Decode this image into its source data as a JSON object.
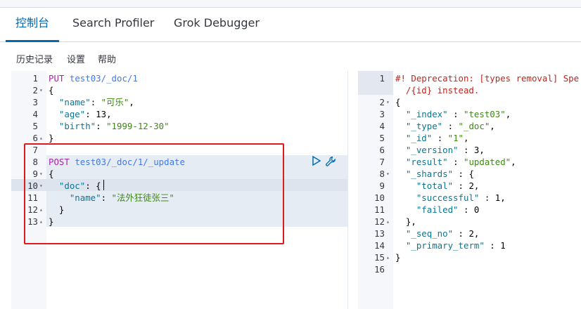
{
  "tabs": [
    {
      "label": "控制台",
      "active": true
    },
    {
      "label": "Search Profiler",
      "active": false
    },
    {
      "label": "Grok Debugger",
      "active": false
    }
  ],
  "menu": {
    "history": "历史记录",
    "settings": "设置",
    "help": "帮助"
  },
  "request_lines": [
    {
      "n": "1",
      "fold": "",
      "text": "PUT test03/_doc/1"
    },
    {
      "n": "2",
      "fold": "▾",
      "text": "{"
    },
    {
      "n": "3",
      "fold": "",
      "text": "  \"name\": \"可乐\","
    },
    {
      "n": "4",
      "fold": "",
      "text": "  \"age\": 13,"
    },
    {
      "n": "5",
      "fold": "",
      "text": "  \"birth\": \"1999-12-30\""
    },
    {
      "n": "6",
      "fold": "▴",
      "text": "}"
    },
    {
      "n": "7",
      "fold": "",
      "text": ""
    },
    {
      "n": "8",
      "fold": "",
      "text": "POST test03/_doc/1/_update"
    },
    {
      "n": "9",
      "fold": "▾",
      "text": "{"
    },
    {
      "n": "10",
      "fold": "▾",
      "text": "  \"doc\": {"
    },
    {
      "n": "11",
      "fold": "",
      "text": "    \"name\": \"法外狂徒张三\""
    },
    {
      "n": "12",
      "fold": "▴",
      "text": "  }"
    },
    {
      "n": "13",
      "fold": "▴",
      "text": "}"
    }
  ],
  "response_lines": [
    {
      "n": "1",
      "fold": "",
      "text": "#! Deprecation: [types removal] Spe"
    },
    {
      "n": "",
      "fold": "",
      "text": "  /{id} instead."
    },
    {
      "n": "2",
      "fold": "▾",
      "text": "{"
    },
    {
      "n": "3",
      "fold": "",
      "text": "  \"_index\" : \"test03\","
    },
    {
      "n": "4",
      "fold": "",
      "text": "  \"_type\" : \"_doc\","
    },
    {
      "n": "5",
      "fold": "",
      "text": "  \"_id\" : \"1\","
    },
    {
      "n": "6",
      "fold": "",
      "text": "  \"_version\" : 3,"
    },
    {
      "n": "7",
      "fold": "",
      "text": "  \"result\" : \"updated\","
    },
    {
      "n": "8",
      "fold": "▾",
      "text": "  \"_shards\" : {"
    },
    {
      "n": "9",
      "fold": "",
      "text": "    \"total\" : 2,"
    },
    {
      "n": "10",
      "fold": "",
      "text": "    \"successful\" : 1,"
    },
    {
      "n": "11",
      "fold": "",
      "text": "    \"failed\" : 0"
    },
    {
      "n": "12",
      "fold": "▴",
      "text": "  },"
    },
    {
      "n": "13",
      "fold": "",
      "text": "  \"_seq_no\" : 2,"
    },
    {
      "n": "14",
      "fold": "",
      "text": "  \"_primary_term\" : 1"
    },
    {
      "n": "15",
      "fold": "▴",
      "text": "}"
    },
    {
      "n": "16",
      "fold": "",
      "text": ""
    }
  ],
  "icons": {
    "run": "play-icon",
    "settings": "wrench-icon"
  },
  "colors": {
    "accent": "#006bb4",
    "highlight_box": "#e0191b"
  }
}
